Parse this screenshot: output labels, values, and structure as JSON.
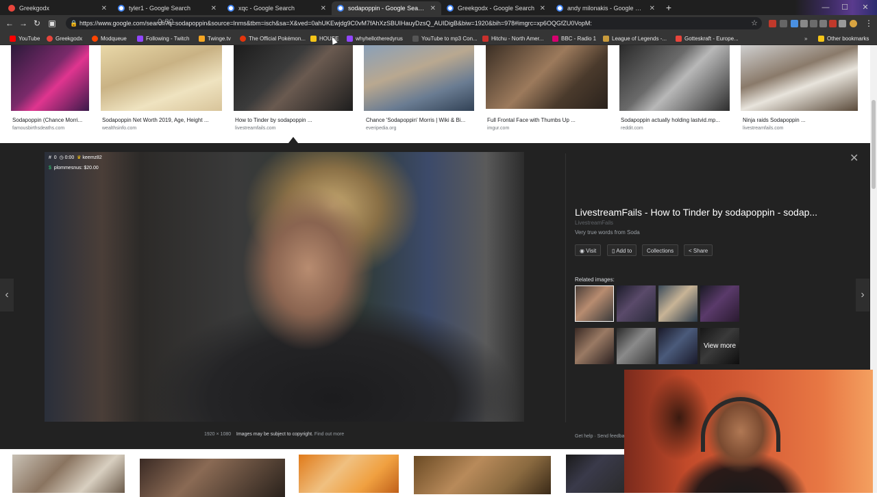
{
  "browser": {
    "tabs": [
      {
        "title": "Greekgodx",
        "color": "#e8453c",
        "active": false
      },
      {
        "title": "tyler1 - Google Search",
        "color": "#ffffff",
        "active": false
      },
      {
        "title": "xqc - Google Search",
        "color": "#ffffff",
        "active": false
      },
      {
        "title": "sodapoppin - Google Search",
        "color": "#ffffff",
        "active": true
      },
      {
        "title": "Greekgodx - Google Search",
        "color": "#ffffff",
        "active": false
      },
      {
        "title": "andy milonakis - Google Search",
        "color": "#ffffff",
        "active": false
      }
    ],
    "url": "https://www.google.com/search?q=sodapoppin&source=lnms&tbm=isch&sa=X&ved=0ahUKEwjdg9C0vM7fAhXzSBUIHauyDzsQ_AUIDigB&biw=1920&bih=978#imgrc=xp6OQGfZU0VopM:",
    "timer_overlay": "0:00"
  },
  "bookmarks": [
    {
      "label": "YouTube",
      "color": "#ff0000"
    },
    {
      "label": "Greekgodx",
      "color": "#e8453c"
    },
    {
      "label": "Modqueue",
      "color": "#ff4500"
    },
    {
      "label": "Following - Twitch",
      "color": "#9146ff"
    },
    {
      "label": "Twinge.tv",
      "color": "#f5a623"
    },
    {
      "label": "The Official Pokémon...",
      "color": "#e3350d"
    },
    {
      "label": "HOUSE",
      "color": "#f5c518"
    },
    {
      "label": "whyhellotheredyrus",
      "color": "#9146ff"
    },
    {
      "label": "YouTube to mp3 Con...",
      "color": "#555555"
    },
    {
      "label": "Hitchu - North Amer...",
      "color": "#c9302c"
    },
    {
      "label": "BBC - Radio 1",
      "color": "#d6006f"
    },
    {
      "label": "League of Legends -...",
      "color": "#c89b3c"
    },
    {
      "label": "Gotteskraft - Europe...",
      "color": "#e8453c"
    },
    {
      "label": "Other bookmarks",
      "color": "#f5c518"
    }
  ],
  "top_results": [
    {
      "caption": "Sodapoppin (Chance Morri...",
      "source": "famousbirthsdeaths.com"
    },
    {
      "caption": "Sodapoppin Net Worth 2019, Age, Height ...",
      "source": "wealthsinfo.com"
    },
    {
      "caption": "How to Tinder by sodapoppin ...",
      "source": "livestreamfails.com"
    },
    {
      "caption": "Chance 'Sodapoppin' Morris | Wiki & Bi...",
      "source": "everipedia.org"
    },
    {
      "caption": "Full Frontal Face with Thumbs Up ...",
      "source": "imgur.com"
    },
    {
      "caption": "Sodapoppin actually holding lastvid.mp...",
      "source": "reddit.com"
    },
    {
      "caption": "Ninja raids Sodapoppin ...",
      "source": "livestreamfails.com"
    }
  ],
  "preview": {
    "overlay_hash": "#",
    "overlay_zero": "0",
    "overlay_time": "0:00",
    "overlay_user": "keemz82",
    "overlay_donation": "plommesnus: $20.00",
    "title": "LivestreamFails - How to Tinder by sodapoppin - sodap...",
    "site": "LivestreamFails",
    "description": "Very true words from Soda",
    "actions": {
      "visit": "Visit",
      "add_to": "Add to",
      "collections": "Collections",
      "share": "Share"
    },
    "related_label": "Related images:",
    "view_more": "View more",
    "dimensions": "1920 × 1080",
    "copyright": "Images may be subject to copyright.",
    "find_out_more": "Find out more",
    "footer_right": "Get help  ·  Send feedback"
  },
  "colors": {
    "panel_bg": "#222222",
    "chrome_bg": "#353535",
    "accent_link": "#8ab4f8"
  }
}
